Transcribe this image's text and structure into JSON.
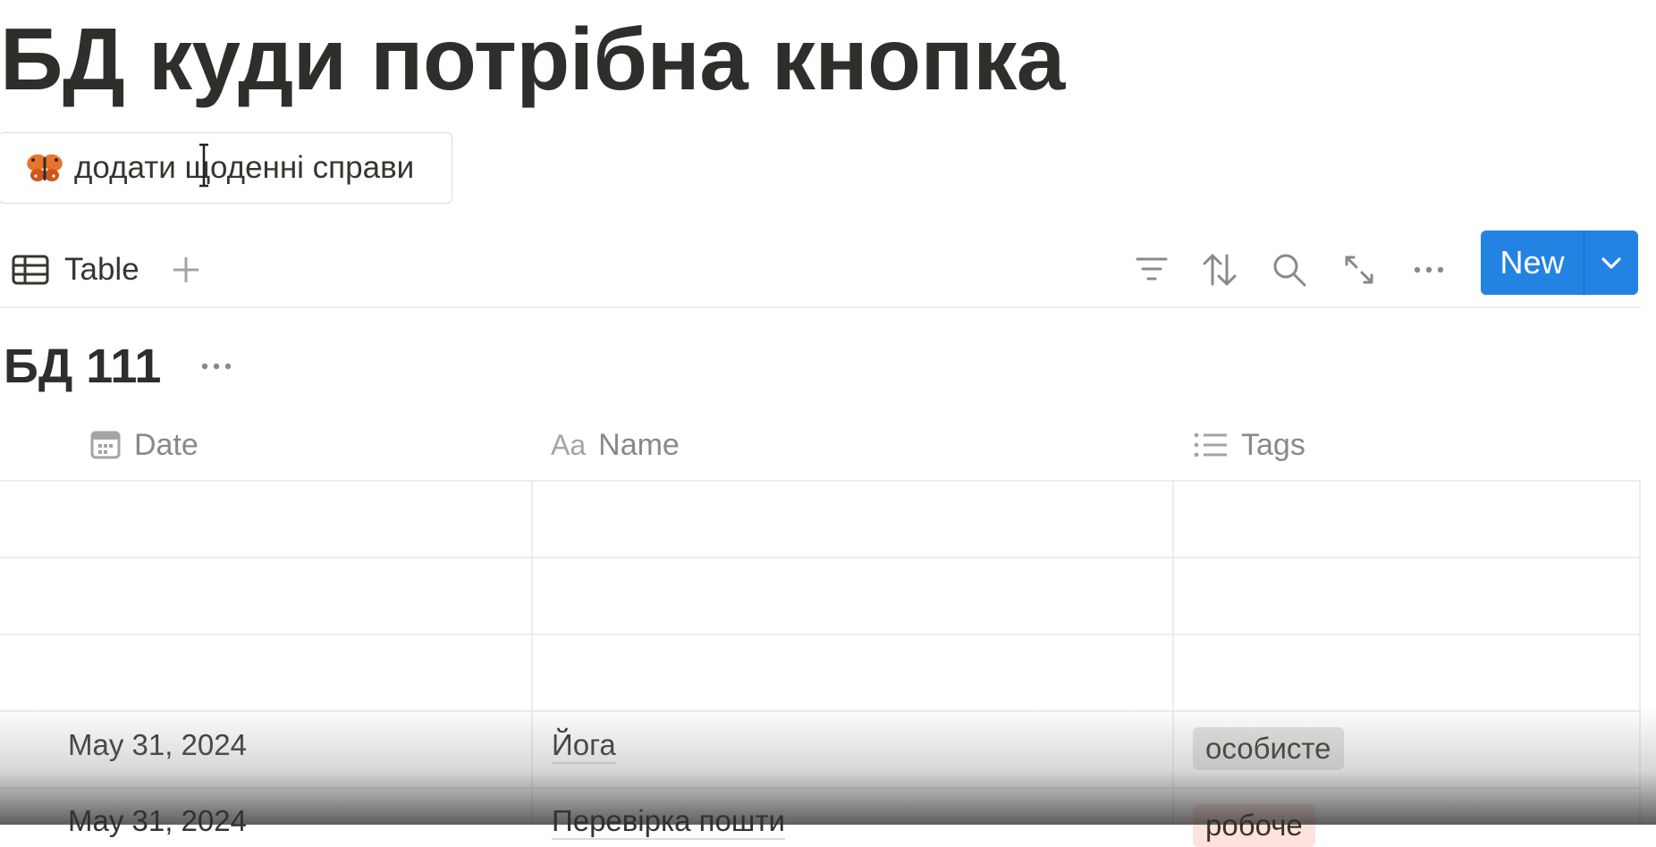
{
  "page": {
    "title": "БД куди потрібна кнопка"
  },
  "page_button": {
    "icon": "butterfly-icon",
    "label": "додати щоденні справи"
  },
  "toolbar": {
    "view_tab_label": "Table",
    "view_tab_icon": "table-icon",
    "add_view_icon": "plus-icon",
    "tools": [
      "filter-icon",
      "sort-icon",
      "search-icon",
      "expand-icon",
      "more-icon"
    ],
    "new_label": "New",
    "accent": "#2383e2"
  },
  "database": {
    "title": "БД 111",
    "columns": [
      {
        "icon": "calendar-icon",
        "label": "Date"
      },
      {
        "icon": "text-icon",
        "label": "Name",
        "icon_text": "Aa"
      },
      {
        "icon": "list-icon",
        "label": "Tags"
      }
    ],
    "rows": [
      {
        "date": "",
        "name": "",
        "tags": []
      },
      {
        "date": "",
        "name": "",
        "tags": []
      },
      {
        "date": "",
        "name": "",
        "tags": []
      },
      {
        "date": "May 31, 2024",
        "name": "Йога",
        "tags": [
          {
            "label": "особисте",
            "color": "#e3e2e0"
          }
        ]
      },
      {
        "date": "May 31, 2024",
        "name": "Перевірка пошти",
        "tags": [
          {
            "label": "робоче",
            "color": "#ffe2dd"
          }
        ]
      }
    ]
  }
}
